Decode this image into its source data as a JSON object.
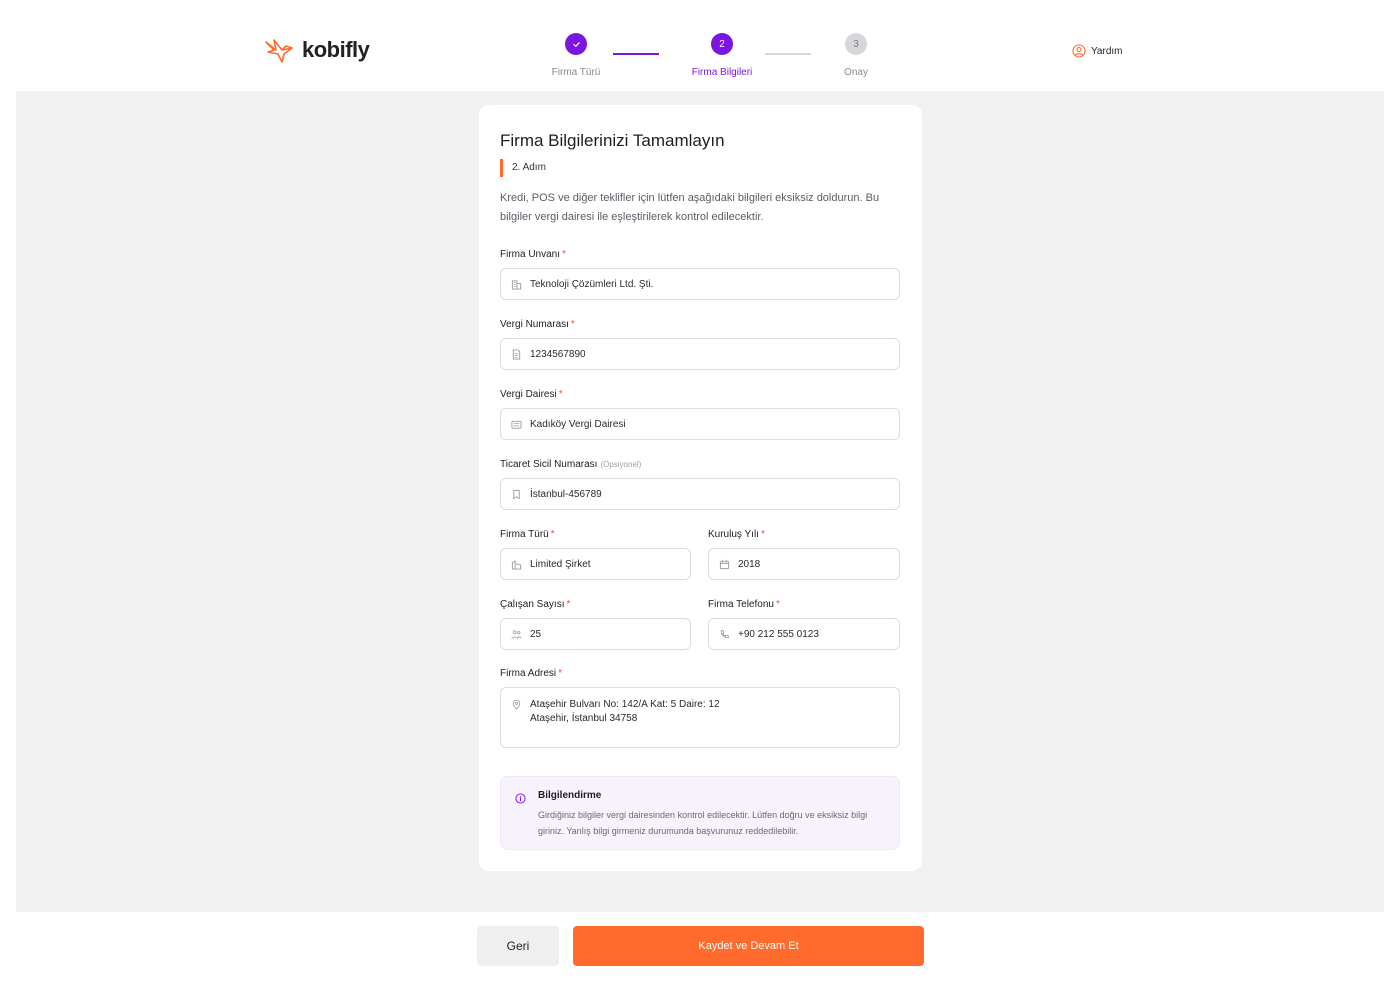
{
  "brand": {
    "name": "kobifly",
    "accent": "#ff6b2c",
    "primary": "#7a16e0"
  },
  "header": {
    "help_label": "Yardım"
  },
  "stepper": {
    "steps": [
      {
        "label": "Firma Türü",
        "number": "1",
        "state": "completed"
      },
      {
        "label": "Firma Bilgileri",
        "number": "2",
        "state": "active"
      },
      {
        "label": "Onay",
        "number": "3",
        "state": "pending"
      }
    ]
  },
  "form": {
    "title": "Firma Bilgilerinizi Tamamlayın",
    "step_tag": "2. Adım",
    "description": "Kredi, POS ve diğer teklifler için lütfen aşağıdaki bilgileri eksiksiz doldurun. Bu bilgiler vergi dairesi ile eşleştirilerek kontrol edilecektir.",
    "required_mark": "*",
    "fields": {
      "company_title": {
        "label": "Firma Unvanı",
        "value": "Teknoloji Çözümleri Ltd. Şti.",
        "icon": "building-icon"
      },
      "tax_number": {
        "label": "Vergi Numarası",
        "value": "1234567890",
        "icon": "document-icon"
      },
      "tax_office": {
        "label": "Vergi Dairesi",
        "value": "Kadıköy Vergi Dairesi",
        "icon": "bank-icon"
      },
      "trade_registry": {
        "label": "Ticaret Sicil Numarası",
        "optional": "(Opsiyonel)",
        "value": "İstanbul-456789",
        "icon": "bookmark-icon"
      },
      "company_type": {
        "label": "Firma Türü",
        "value": "Limited Şirket",
        "icon": "building-small-icon"
      },
      "founded_year": {
        "label": "Kuruluş Yılı",
        "value": "2018",
        "icon": "calendar-icon"
      },
      "employee_count": {
        "label": "Çalışan Sayısı",
        "value": "25",
        "icon": "people-icon"
      },
      "company_phone": {
        "label": "Firma Telefonu",
        "value": "+90 212 555 0123",
        "icon": "phone-icon"
      },
      "company_address": {
        "label": "Firma Adresi",
        "line1": "Ataşehir Bulvarı No: 142/A Kat: 5 Daire: 12",
        "line2": "Ataşehir, İstanbul 34758",
        "icon": "location-pin-icon"
      }
    },
    "info": {
      "title": "Bilgilendirme",
      "text": "Girdiğiniz bilgiler vergi dairesinden kontrol edilecektir. Lütfen doğru ve eksiksiz bilgi giriniz. Yanlış bilgi girmeniz durumunda başvurunuz reddedilebilir."
    }
  },
  "footer": {
    "back_label": "Geri",
    "next_label": "Kaydet ve Devam Et"
  }
}
